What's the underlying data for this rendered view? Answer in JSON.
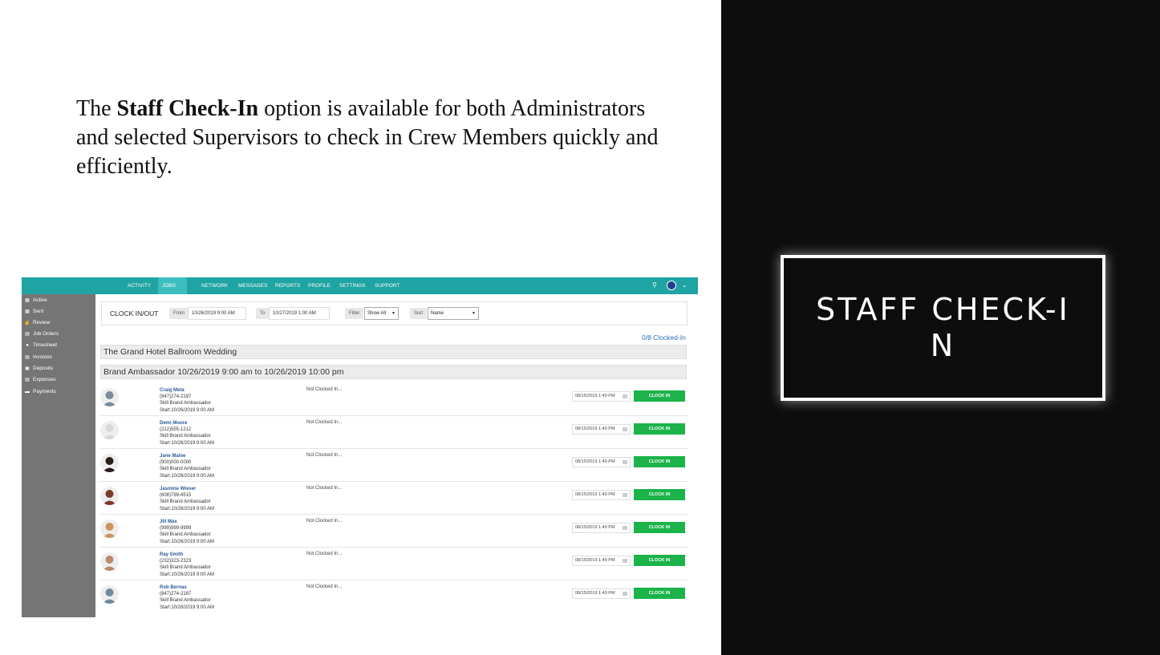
{
  "intro": {
    "before": "The ",
    "bold": "Staff Check-In",
    "after": " option is available for both Administrators and selected Supervisors to check in Crew Members quickly and efficiently."
  },
  "slide_title": "STAFF CHECK-IN",
  "app": {
    "nav": [
      {
        "label": "ACTIVITY"
      },
      {
        "label": "JOBS"
      },
      {
        "label": "NETWORK"
      },
      {
        "label": "MESSAGES"
      },
      {
        "label": "REPORTS"
      },
      {
        "label": "PROFILE"
      },
      {
        "label": "SETTINGS"
      },
      {
        "label": "SUPPORT"
      }
    ],
    "active_nav": "JOBS",
    "sidebar": [
      {
        "label": "Active",
        "icon": "calendar-icon"
      },
      {
        "label": "Sent",
        "icon": "calendar-icon"
      },
      {
        "label": "Review",
        "icon": "thumbs-up-icon"
      },
      {
        "label": "Job Orders",
        "icon": "grid-icon"
      },
      {
        "label": "Timesheet",
        "icon": "clock-icon"
      },
      {
        "label": "Invoices",
        "icon": "document-icon"
      },
      {
        "label": "Deposits",
        "icon": "money-icon"
      },
      {
        "label": "Expenses",
        "icon": "receipt-icon"
      },
      {
        "label": "Payments",
        "icon": "card-icon"
      }
    ],
    "toolbar": {
      "title": "CLOCK IN/OUT",
      "from_label": "From",
      "from_value": "10/26/2019 9:00 AM",
      "to_label": "To",
      "to_value": "10/27/2019 1:00 AM",
      "filter_label": "Filter",
      "filter_value": "Show All",
      "sort_label": "Sort",
      "sort_value": "Name"
    },
    "clocked_count": "0/8 Clocked-In",
    "event_title": "The Grand Hotel Ballroom Wedding",
    "shift_title": "Brand Ambassador 10/26/2019 9:00 am to 10/26/2019 10:00 pm",
    "button_label": "CLOCK IN",
    "staff": [
      {
        "name": "Craig Meta",
        "phone": "(847)274-2187",
        "skill": "Skill Brand Ambassador",
        "start": "Start:10/26/2019 9:00 AM",
        "status": "Not Clocked In...",
        "datetime": "08/15/2019 1:49 PM",
        "avatar_color": "#7a8aa0"
      },
      {
        "name": "Demi Moore",
        "phone": "(212)555-1212",
        "skill": "Skill Brand Ambassador",
        "start": "Start:10/26/2019 9:00 AM",
        "status": "Not Clocked In...",
        "datetime": "08/15/2019 1:49 PM",
        "avatar_color": "#d8d8d8"
      },
      {
        "name": "Jane Maine",
        "phone": "(900)000-0000",
        "skill": "Skill Brand Ambassador",
        "start": "Start:10/26/2019 9:00 AM",
        "status": "Not Clocked In...",
        "datetime": "08/15/2019 1:49 PM",
        "avatar_color": "#2b1d1a"
      },
      {
        "name": "Jasmine Wieser",
        "phone": "(608)799-4515",
        "skill": "Skill Brand Ambassador",
        "start": "Start:10/26/2019 9:00 AM",
        "status": "Not Clocked In...",
        "datetime": "08/15/2019 1:49 PM",
        "avatar_color": "#7a3a2a"
      },
      {
        "name": "Jill Max",
        "phone": "(999)999-9999",
        "skill": "Skill Brand Ambassador",
        "start": "Start:10/26/2019 9:00 AM",
        "status": "Not Clocked In...",
        "datetime": "08/15/2019 1:49 PM",
        "avatar_color": "#c9955e"
      },
      {
        "name": "Ray Smith",
        "phone": "(232)323-2323",
        "skill": "Skill Brand Ambassador",
        "start": "Start:10/26/2019 9:00 AM",
        "status": "Not Clocked In...",
        "datetime": "08/15/2019 1:49 PM",
        "avatar_color": "#b98a6c"
      },
      {
        "name": "Rob Bernas",
        "phone": "(847)274-2187",
        "skill": "Skill Brand Ambassador",
        "start": "Start:10/26/2019 9:00 AM",
        "status": "Not Clocked In...",
        "datetime": "08/15/2019 1:49 PM",
        "avatar_color": "#6d8aa0"
      }
    ],
    "colors": {
      "nav_bg": "#1fa3a3",
      "sidebar_bg": "#757575",
      "button_green": "#1bb34a",
      "link_blue": "#2a5a9b"
    }
  }
}
